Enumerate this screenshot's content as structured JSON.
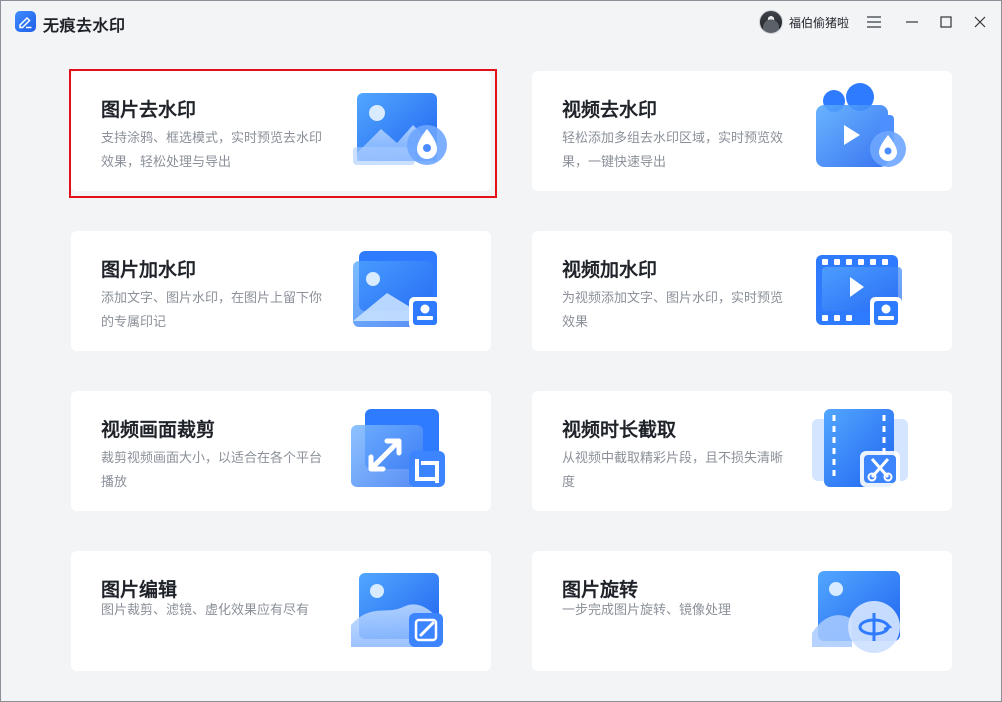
{
  "app": {
    "title": "无痕去水印"
  },
  "user": {
    "name": "福伯偷猪啦"
  },
  "cards": [
    {
      "title": "图片去水印",
      "desc": "支持涂鸦、框选模式，实时预览去水印效果，轻松处理与导出",
      "icon": "image-remove-watermark-icon",
      "selected": true
    },
    {
      "title": "视频去水印",
      "desc": "轻松添加多组去水印区域，实时预览效果，一键快速导出",
      "icon": "video-remove-watermark-icon"
    },
    {
      "title": "图片加水印",
      "desc": "添加文字、图片水印，在图片上留下你的专属印记",
      "icon": "image-add-watermark-icon"
    },
    {
      "title": "视频加水印",
      "desc": "为视频添加文字、图片水印，实时预览效果",
      "icon": "video-add-watermark-icon"
    },
    {
      "title": "视频画面裁剪",
      "desc": "裁剪视频画面大小，以适合在各个平台播放",
      "icon": "video-crop-icon"
    },
    {
      "title": "视频时长截取",
      "desc": "从视频中截取精彩片段，且不损失清晰度",
      "icon": "video-trim-icon"
    },
    {
      "title": "图片编辑",
      "desc": "图片裁剪、滤镜、虚化效果应有尽有",
      "icon": "image-edit-icon"
    },
    {
      "title": "图片旋转",
      "desc": "一步完成图片旋转、镜像处理",
      "icon": "image-rotate-icon"
    }
  ],
  "colors": {
    "accent": "#2f7bff",
    "selection": "#e3101a",
    "background": "#f3f4f6"
  }
}
